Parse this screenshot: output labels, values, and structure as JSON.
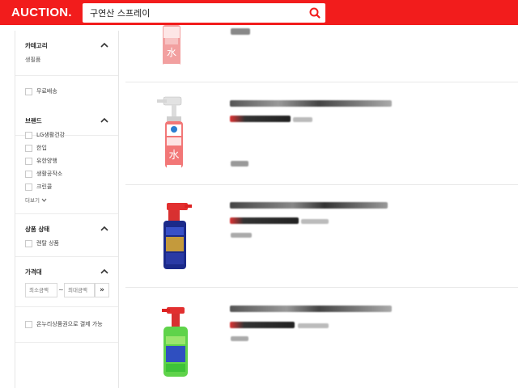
{
  "header": {
    "logo": "AUCTION.",
    "search_value": "구연산 스프레이"
  },
  "sidebar": {
    "category": {
      "title": "카테고리",
      "value": "생필품"
    },
    "free_shipping": {
      "label": "무료배송"
    },
    "brand": {
      "title": "브랜드",
      "items": [
        "LG생활건강",
        "한입",
        "유한양행",
        "생활공작소",
        "크린콜"
      ],
      "more": "더보기"
    },
    "condition": {
      "title": "상품 상태",
      "items": [
        "렌탈 상품"
      ]
    },
    "price": {
      "title": "가격대",
      "min_placeholder": "최소금액",
      "max_placeholder": "최대금액",
      "separator": "~",
      "go": "»"
    },
    "onnuri": {
      "label": "온누리상품권으로 결제 가능"
    }
  },
  "colors": {
    "brand_red": "#f21c1c"
  }
}
